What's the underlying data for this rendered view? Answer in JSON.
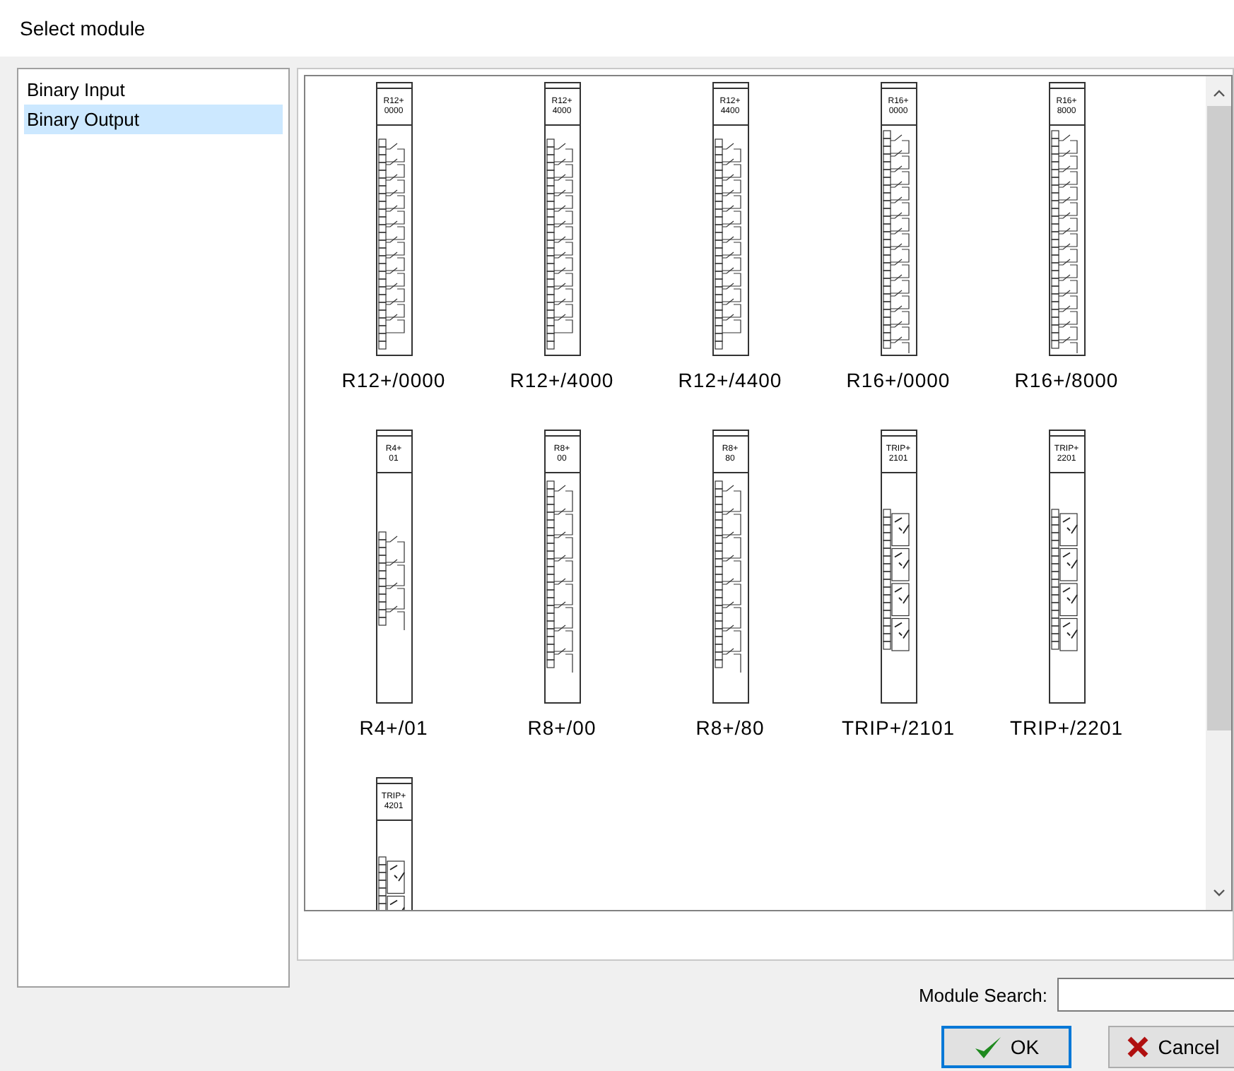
{
  "window": {
    "title": "Select module"
  },
  "categories": [
    {
      "label": "Binary Input",
      "selected": false
    },
    {
      "label": "Binary Output",
      "selected": true
    }
  ],
  "modules": [
    {
      "header": [
        "R12+",
        "0000"
      ],
      "label": "R12+/0000",
      "kind": "relay12"
    },
    {
      "header": [
        "R12+",
        "4000"
      ],
      "label": "R12+/4000",
      "kind": "relay12"
    },
    {
      "header": [
        "R12+",
        "4400"
      ],
      "label": "R12+/4400",
      "kind": "relay12"
    },
    {
      "header": [
        "R16+",
        "0000"
      ],
      "label": "R16+/0000",
      "kind": "relay16"
    },
    {
      "header": [
        "R16+",
        "8000"
      ],
      "label": "R16+/8000",
      "kind": "relay16"
    },
    {
      "header": [
        "R4+",
        "01"
      ],
      "label": "R4+/01",
      "kind": "relay4"
    },
    {
      "header": [
        "R8+",
        "00"
      ],
      "label": "R8+/00",
      "kind": "relay8"
    },
    {
      "header": [
        "R8+",
        "80"
      ],
      "label": "R8+/80",
      "kind": "relay8"
    },
    {
      "header": [
        "TRIP+",
        "2101"
      ],
      "label": "TRIP+/2101",
      "kind": "trip"
    },
    {
      "header": [
        "TRIP+",
        "2201"
      ],
      "label": "TRIP+/2201",
      "kind": "trip"
    },
    {
      "header": [
        "TRIP+",
        "4201"
      ],
      "kind": "trip"
    }
  ],
  "search": {
    "label": "Module Search:"
  },
  "buttons": [
    {
      "label": "OK",
      "kind": "ok",
      "focused": true
    },
    {
      "label": "Cancel",
      "kind": "cancel",
      "focused": false
    }
  ]
}
